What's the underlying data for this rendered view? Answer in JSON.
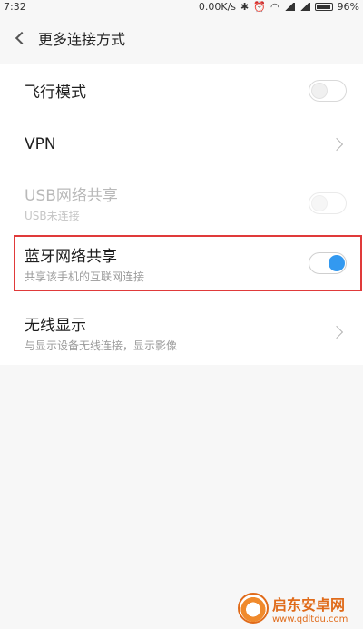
{
  "status_bar": {
    "time": "7:32",
    "speed": "0.00K/s",
    "battery": "96%"
  },
  "header": {
    "title": "更多连接方式"
  },
  "rows": [
    {
      "title": "飞行模式",
      "control": "toggle",
      "state": "off"
    },
    {
      "title": "VPN",
      "control": "chevron"
    },
    {
      "title": "USB网络共享",
      "subtitle": "USB未连接",
      "control": "toggle",
      "state": "disabled"
    },
    {
      "title": "蓝牙网络共享",
      "subtitle": "共享该手机的互联网连接",
      "control": "toggle",
      "state": "on"
    },
    {
      "title": "无线显示",
      "subtitle": "与显示设备无线连接，显示影像",
      "control": "chevron"
    }
  ],
  "colors": {
    "accent": "#3399f0",
    "highlight": "#e03a3a"
  },
  "watermark": {
    "name": "启东安卓网",
    "url": "www.qdltdu.com"
  }
}
